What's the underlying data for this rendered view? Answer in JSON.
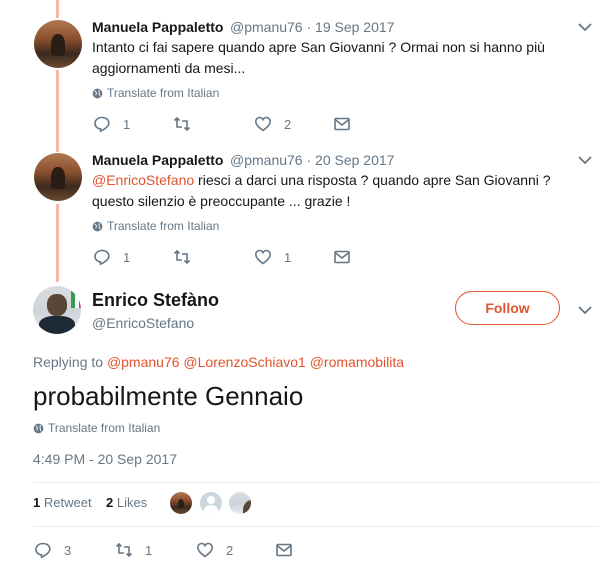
{
  "replies": [
    {
      "name": "Manuela Pappaletto",
      "handle": "@pmanu76",
      "date": "· 19 Sep 2017",
      "text": "Intanto ci fai sapere quando apre San Giovanni ? Ormai non si hanno più aggiornamenti da mesi...",
      "mention": "",
      "translate": "Translate from Italian",
      "replies_count": "1",
      "retweets_count": "",
      "likes_count": "2"
    },
    {
      "name": "Manuela Pappaletto",
      "handle": "@pmanu76",
      "date": "· 20 Sep 2017",
      "mention": "@EnricoStefano",
      "text": " riesci a darci una risposta ? quando apre San Giovanni ? questo silenzio è preoccupante ... grazie !",
      "translate": "Translate from Italian",
      "replies_count": "1",
      "retweets_count": "",
      "likes_count": "1"
    }
  ],
  "main_tweet": {
    "name": "Enrico Stefàno",
    "handle": "@EnricoStefano",
    "follow_label": "Follow",
    "replying_prefix": "Replying to",
    "replying_to": [
      "@pmanu76",
      "@LorenzoSchiavo1",
      "@romamobilita"
    ],
    "text": "probabilmente Gennaio",
    "translate": "Translate from Italian",
    "timestamp": "4:49 PM - 20 Sep 2017",
    "retweets_count": "1",
    "retweets_label": "Retweet",
    "likes_count": "2",
    "likes_label": "Likes",
    "action_replies": "3",
    "action_retweets": "1",
    "action_likes": "2"
  },
  "colors": {
    "accent": "#e0542e",
    "thread_line": "#f9b6a8",
    "muted": "#657786"
  }
}
